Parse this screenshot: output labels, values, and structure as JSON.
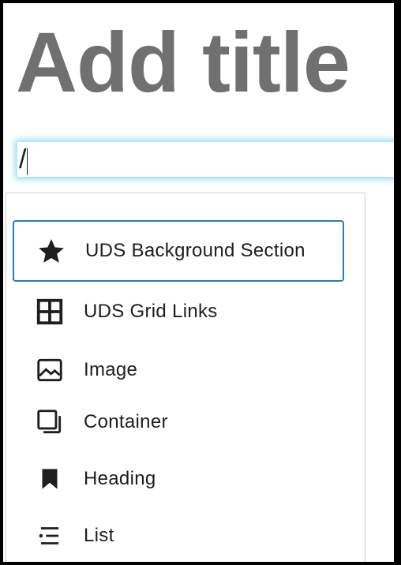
{
  "editor": {
    "title_placeholder": "Add title",
    "block_input_value": "/"
  },
  "inserter": {
    "items": [
      {
        "label": "UDS Background Section",
        "icon": "star-icon"
      },
      {
        "label": "UDS Grid Links",
        "icon": "grid-icon"
      },
      {
        "label": "Image",
        "icon": "image-icon"
      },
      {
        "label": "Container",
        "icon": "container-icon"
      },
      {
        "label": "Heading",
        "icon": "bookmark-icon"
      },
      {
        "label": "List",
        "icon": "list-icon"
      }
    ],
    "selected_index": 0
  },
  "colors": {
    "title": "#707070",
    "focus_ring": "#2e7ab8",
    "input_glow": "#9ad8f2",
    "text": "#1e1e1e"
  }
}
